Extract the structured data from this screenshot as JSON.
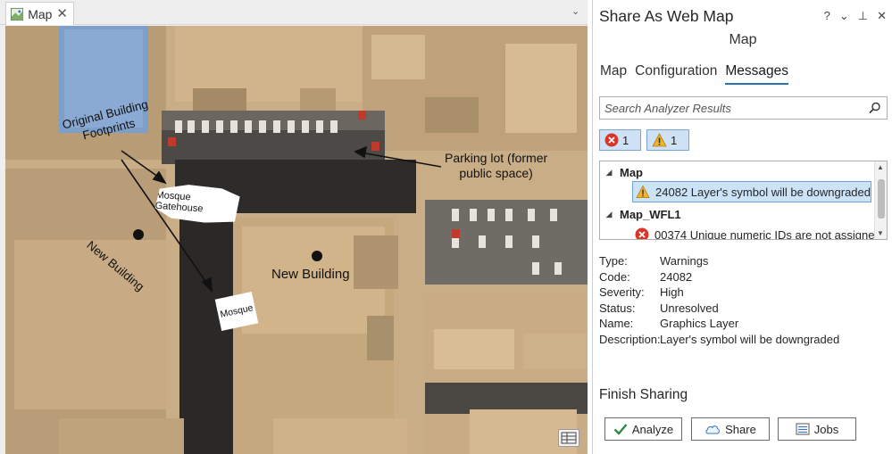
{
  "map_view": {
    "tab_label": "Map",
    "tab_close": "✕",
    "tab_dropdown": "⌄",
    "annotations": {
      "footprints_line1": "Original Building",
      "footprints_line2": "Footprints",
      "new_building_rotated": "New Building",
      "parking_line1": "Parking lot (former",
      "parking_line2": "public space)",
      "new_building": "New Building",
      "mosque_gatehouse": "Mosque Gatehouse",
      "mosque": "Mosque"
    }
  },
  "panel": {
    "title": "Share As Web Map",
    "subtitle": "Map",
    "controls": [
      "?",
      "⌄",
      "⊥",
      "✕"
    ],
    "tabs": [
      {
        "label": "Map",
        "active": false
      },
      {
        "label": "Configuration",
        "active": false
      },
      {
        "label": "Messages",
        "active": true
      }
    ],
    "search": {
      "placeholder": "Search Analyzer Results"
    },
    "filters": {
      "error_count": "1",
      "warning_count": "1"
    },
    "results": {
      "groups": [
        {
          "name": "Map",
          "messages": [
            {
              "icon": "warning-icon",
              "text": "24082 Layer's symbol will be downgraded",
              "selected": true
            }
          ]
        },
        {
          "name": "Map_WFL1",
          "messages": [
            {
              "icon": "error-icon",
              "text": "00374 Unique numeric IDs are not assigne",
              "selected": false
            }
          ]
        }
      ]
    },
    "details": [
      {
        "key": "Type:",
        "value": "Warnings"
      },
      {
        "key": "Code:",
        "value": "24082"
      },
      {
        "key": "Severity:",
        "value": "High"
      },
      {
        "key": "Status:",
        "value": "Unresolved"
      },
      {
        "key": "Name:",
        "value": "Graphics Layer"
      },
      {
        "key": "Description:",
        "value": "Layer's symbol will be downgraded"
      }
    ],
    "finish": {
      "title": "Finish Sharing",
      "analyze_label": "Analyze",
      "share_label": "Share",
      "jobs_label": "Jobs"
    }
  },
  "colors": {
    "accent": "#2b6fb5",
    "selection_bg": "#cce3f7",
    "error": "#d8362b",
    "warning": "#f0b429",
    "check": "#2e8b3e"
  }
}
